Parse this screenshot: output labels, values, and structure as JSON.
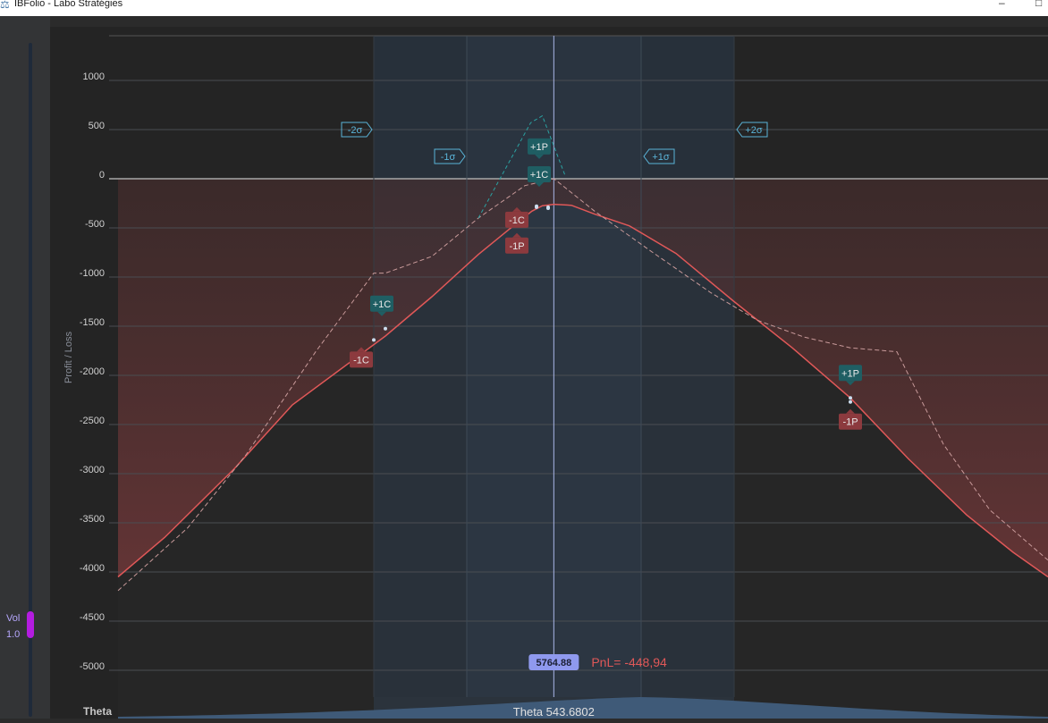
{
  "window": {
    "title": "IBFolio - Labo Stratégies",
    "minimize": "–",
    "maximize": "□"
  },
  "vol_slider": {
    "label": "Vol",
    "value": "1.0",
    "color": "#b41ce0"
  },
  "colors": {
    "pnl": "#e05858",
    "expiry": "#c89a9a",
    "peak": "#2aa3a3",
    "sigma": "#5ab4d8",
    "long_tag": "#1f5e63",
    "short_tag": "#8c3a3e",
    "price_badge": "#8f99ee"
  },
  "chart_data": {
    "type": "line",
    "ylabel": "Profit / Loss",
    "y_ticks": [
      1000,
      500,
      0,
      -500,
      -1000,
      -1500,
      -2000,
      -2500,
      -3000,
      -3500,
      -4000,
      -4500,
      -5000
    ],
    "tick_labels": [
      "1000",
      "500",
      "0",
      "-500",
      "-1000",
      "-1500",
      "-2000",
      "-2500",
      "-3000",
      "-3500",
      "-4000",
      "-4500",
      "-5000"
    ],
    "ylim": [
      -5000,
      1000
    ],
    "xlim": [
      5390,
      6190
    ],
    "current_price": 5764.88,
    "current_price_label": "5764.88",
    "pnl_label": "PnL= -448,94",
    "series": [
      {
        "key": "pnl_now",
        "style": "solid",
        "x": [
          5390,
          5430,
          5490,
          5540,
          5620,
          5660,
          5700,
          5730,
          5746,
          5755,
          5765,
          5780,
          5800,
          5830,
          5870,
          5920,
          5970,
          6020,
          6070,
          6120,
          6160,
          6190
        ],
        "y": [
          -4050,
          -3650,
          -2950,
          -2300,
          -1600,
          -1200,
          -770,
          -480,
          -330,
          -275,
          -260,
          -270,
          -360,
          -480,
          -760,
          -1250,
          -1720,
          -2230,
          -2850,
          -3420,
          -3800,
          -4050
        ]
      },
      {
        "key": "expiry",
        "style": "dashed",
        "x": [
          5390,
          5450,
          5500,
          5560,
          5610,
          5620,
          5660,
          5700,
          5740,
          5765,
          5800,
          5850,
          5900,
          5940,
          5980,
          6020,
          6060,
          6100,
          6140,
          6190
        ],
        "y": [
          -4190,
          -3550,
          -2810,
          -1760,
          -960,
          -960,
          -790,
          -400,
          -70,
          0,
          -330,
          -750,
          -1160,
          -1440,
          -1610,
          -1720,
          -1760,
          -2700,
          -3370,
          -3880
        ]
      },
      {
        "key": "peak",
        "style": "dashed",
        "x": [
          5700,
          5745,
          5755,
          5775
        ],
        "y": [
          -400,
          570,
          640,
          20
        ]
      }
    ],
    "markers": [
      {
        "x": 5620,
        "y": -1525,
        "label": "+1C",
        "kind": "long"
      },
      {
        "x": 5610,
        "y": -1640,
        "label": "-1C",
        "kind": "short"
      },
      {
        "x": 5760,
        "y": -290,
        "label": "+1P",
        "kind": "long"
      },
      {
        "x": 5760,
        "y": -300,
        "label": "+1C",
        "kind": "long"
      },
      {
        "x": 5750,
        "y": -290,
        "label": "-1C",
        "kind": "short"
      },
      {
        "x": 5750,
        "y": -280,
        "label": "-1P",
        "kind": "short"
      },
      {
        "x": 6020,
        "y": -2230,
        "label": "+1P",
        "kind": "long"
      },
      {
        "x": 6020,
        "y": -2270,
        "label": "-1P",
        "kind": "short"
      }
    ],
    "sigma_bands": [
      {
        "label": "-2σ",
        "x": 5610
      },
      {
        "label": "-1σ",
        "x": 5690
      },
      {
        "label": "+1σ",
        "x": 5840
      },
      {
        "label": "+2σ",
        "x": 5920
      }
    ],
    "theta": {
      "label": "Theta",
      "value_label": "Theta 543.6802"
    }
  }
}
